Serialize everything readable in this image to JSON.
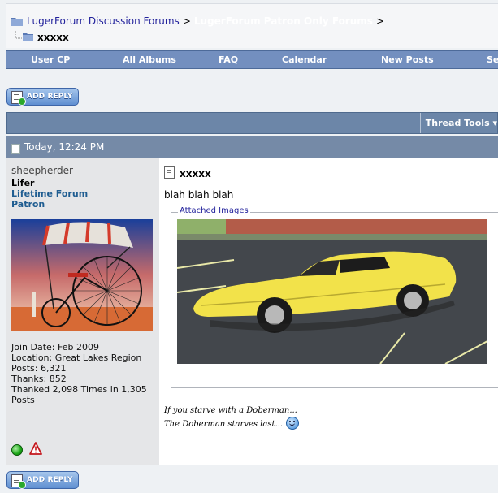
{
  "breadcrumb": {
    "forum_home": "LugerForum Discussion Forums",
    "separator": ">",
    "subforum": "LugerForum Patron Only Forums",
    "thread_title": "xxxxx"
  },
  "navbar": {
    "items": [
      "User CP",
      "All Albums",
      "FAQ",
      "Calendar",
      "New Posts",
      "Se"
    ]
  },
  "buttons": {
    "add_reply": "ADD REPLY"
  },
  "thread_tools": {
    "label": "Thread Tools",
    "arrow": "▾"
  },
  "post": {
    "date": "Today, 12:24 PM",
    "title": "xxxxx",
    "body": "blah blah blah",
    "attachments_label": "Attached Images",
    "signature": {
      "line1": "If you starve with a Doberman...",
      "line2": "The Doberman starves last..."
    }
  },
  "user": {
    "name": "sheepherder",
    "rank": "Lifer",
    "title_line1": "Lifetime Forum",
    "title_line2": "Patron",
    "stats": {
      "join_date": "Join Date: Feb 2009",
      "location": "Location: Great Lakes Region",
      "posts": "Posts: 6,321",
      "thanks": "Thanks: 852",
      "thanked_line1": "Thanked 2,098 Times in 1,305",
      "thanked_line2": "Posts"
    }
  },
  "icons": {
    "online": "online-status-icon",
    "report": "report-post-icon"
  },
  "colors": {
    "navbar": "#738fbf",
    "post_header": "#758aa7",
    "user_title": "#1f5d91",
    "link": "#22229c"
  }
}
